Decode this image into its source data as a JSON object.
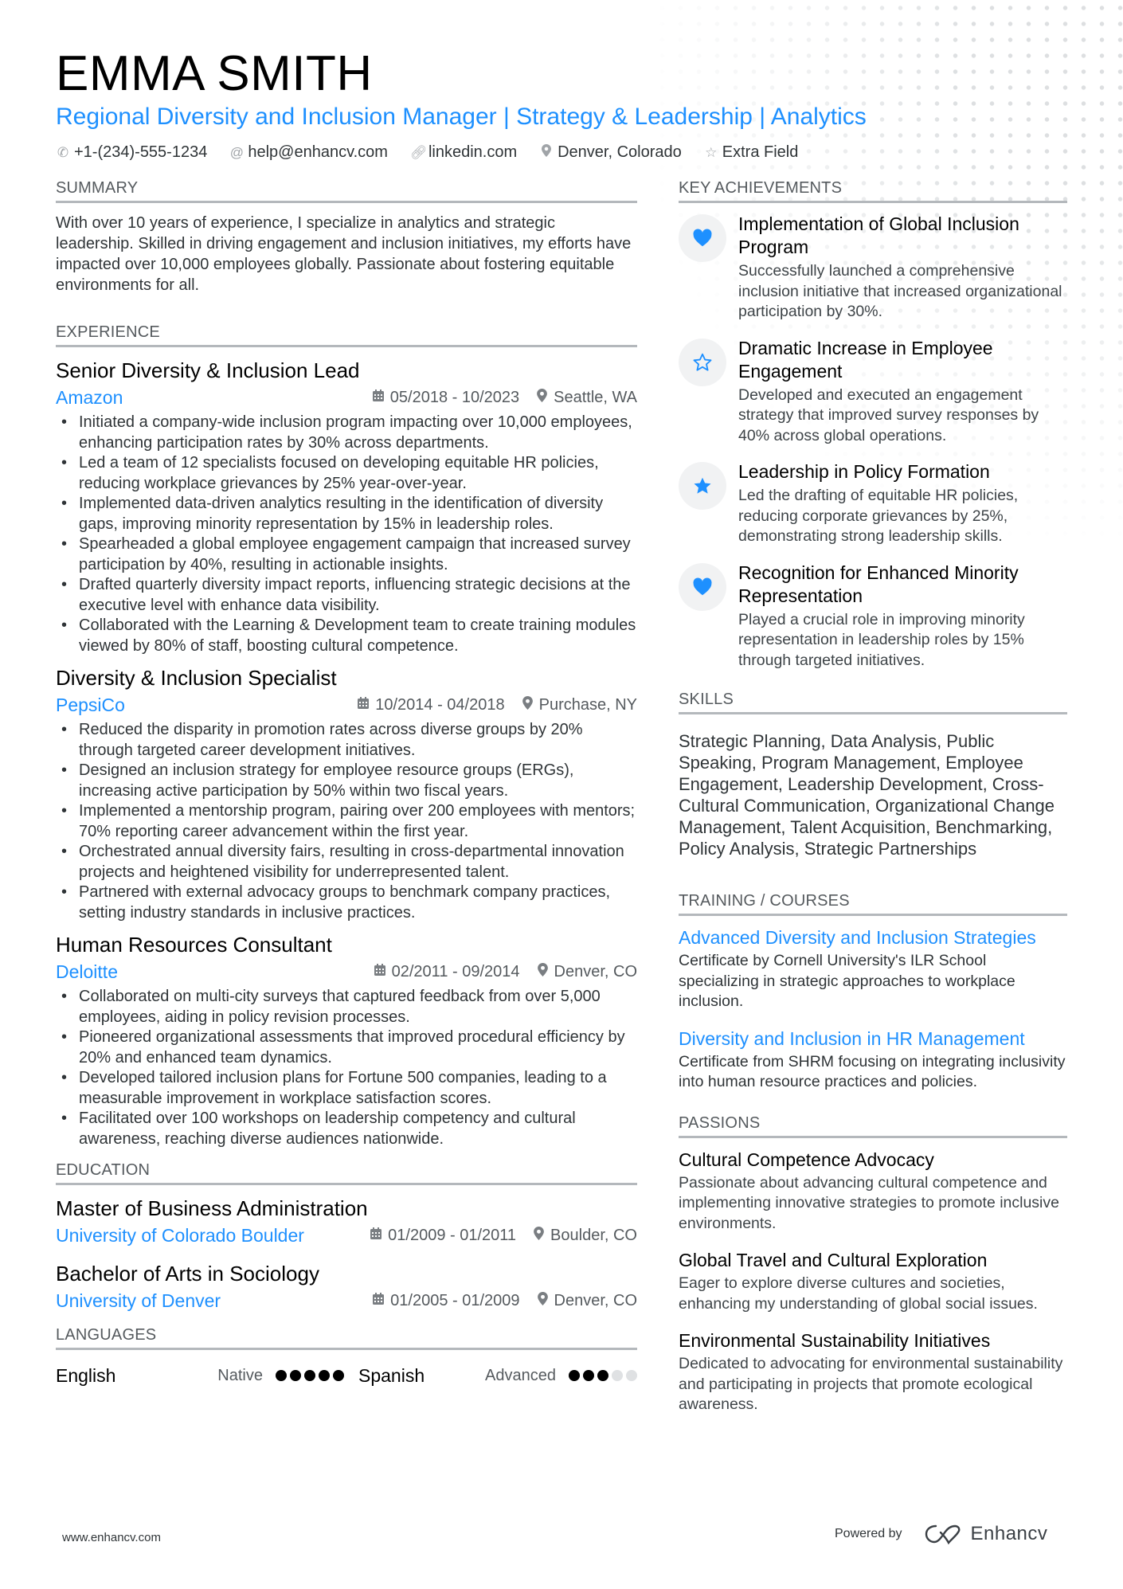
{
  "header": {
    "name": "EMMA SMITH",
    "title": "Regional Diversity and Inclusion Manager | Strategy & Leadership | Analytics",
    "contacts": [
      {
        "icon": "phone-icon",
        "text": "+1-(234)-555-1234"
      },
      {
        "icon": "at-icon",
        "text": "help@enhancv.com"
      },
      {
        "icon": "link-icon",
        "text": "linkedin.com"
      },
      {
        "icon": "location-pin-icon",
        "text": "Denver, Colorado"
      },
      {
        "icon": "star-outline-icon",
        "text": "Extra Field"
      }
    ]
  },
  "summary": {
    "heading": "SUMMARY",
    "text": "With over 10 years of experience, I specialize in analytics and strategic leadership. Skilled in driving engagement and inclusion initiatives, my efforts have impacted over 10,000 employees globally. Passionate about fostering equitable environments for all."
  },
  "experience": {
    "heading": "EXPERIENCE",
    "jobs": [
      {
        "title": "Senior Diversity & Inclusion Lead",
        "company": "Amazon",
        "dates": "05/2018 - 10/2023",
        "location": "Seattle, WA",
        "bullets": [
          "Initiated a company-wide inclusion program impacting over 10,000 employees, enhancing participation rates by 30% across departments.",
          "Led a team of 12 specialists focused on developing equitable HR policies, reducing workplace grievances by 25% year-over-year.",
          "Implemented data-driven analytics resulting in the identification of diversity gaps, improving minority representation by 15% in leadership roles.",
          "Spearheaded a global employee engagement campaign that increased survey participation by 40%, resulting in actionable insights.",
          "Drafted quarterly diversity impact reports, influencing strategic decisions at the executive level with enhance data visibility.",
          "Collaborated with the Learning & Development team to create training modules viewed by 80% of staff, boosting cultural competence."
        ]
      },
      {
        "title": "Diversity & Inclusion Specialist",
        "company": "PepsiCo",
        "dates": "10/2014 - 04/2018",
        "location": "Purchase, NY",
        "bullets": [
          "Reduced the disparity in promotion rates across diverse groups by 20% through targeted career development initiatives.",
          "Designed an inclusion strategy for employee resource groups (ERGs), increasing active participation by 50% within two fiscal years.",
          "Implemented a mentorship program, pairing over 200 employees with mentors; 70% reporting career advancement within the first year.",
          "Orchestrated annual diversity fairs, resulting in cross-departmental innovation projects and heightened visibility for underrepresented talent.",
          "Partnered with external advocacy groups to benchmark company practices, setting industry standards in inclusive practices."
        ]
      },
      {
        "title": "Human Resources Consultant",
        "company": "Deloitte",
        "dates": "02/2011 - 09/2014",
        "location": "Denver, CO",
        "bullets": [
          "Collaborated on multi-city surveys that captured feedback from over 5,000 employees, aiding in policy revision processes.",
          "Pioneered organizational assessments that improved procedural efficiency by 20% and enhanced team dynamics.",
          "Developed tailored inclusion plans for Fortune 500 companies, leading to a measurable improvement in workplace satisfaction scores.",
          "Facilitated over 100 workshops on leadership competency and cultural awareness, reaching diverse audiences nationwide."
        ]
      }
    ]
  },
  "education": {
    "heading": "EDUCATION",
    "items": [
      {
        "degree": "Master of Business Administration",
        "school": "University of Colorado Boulder",
        "dates": "01/2009 - 01/2011",
        "location": "Boulder, CO"
      },
      {
        "degree": "Bachelor of Arts in Sociology",
        "school": "University of Denver",
        "dates": "01/2005 - 01/2009",
        "location": "Denver, CO"
      }
    ]
  },
  "languages": {
    "heading": "LANGUAGES",
    "items": [
      {
        "name": "English",
        "level": "Native",
        "rating": 5,
        "max": 5
      },
      {
        "name": "Spanish",
        "level": "Advanced",
        "rating": 3,
        "max": 5
      }
    ]
  },
  "achievements": {
    "heading": "KEY ACHIEVEMENTS",
    "items": [
      {
        "icon": "heart-icon",
        "title": "Implementation of Global Inclusion Program",
        "desc": "Successfully launched a comprehensive inclusion initiative that increased organizational participation by 30%."
      },
      {
        "icon": "star-outline-icon",
        "title": "Dramatic Increase in Employee Engagement",
        "desc": "Developed and executed an engagement strategy that improved survey responses by 40% across global operations."
      },
      {
        "icon": "star-icon",
        "title": "Leadership in Policy Formation",
        "desc": "Led the drafting of equitable HR policies, reducing corporate grievances by 25%, demonstrating strong leadership skills."
      },
      {
        "icon": "heart-icon",
        "title": "Recognition for Enhanced Minority Representation",
        "desc": "Played a crucial role in improving minority representation in leadership roles by 15% through targeted initiatives."
      }
    ]
  },
  "skills": {
    "heading": "SKILLS",
    "text": "Strategic Planning, Data Analysis, Public Speaking, Program Management, Employee Engagement, Leadership Development, Cross-Cultural Communication, Organizational Change Management, Talent Acquisition, Benchmarking, Policy Analysis, Strategic Partnerships"
  },
  "training": {
    "heading": "TRAINING / COURSES",
    "items": [
      {
        "title": "Advanced Diversity and Inclusion Strategies",
        "desc": "Certificate by Cornell University's ILR School specializing in strategic approaches to workplace inclusion."
      },
      {
        "title": "Diversity and Inclusion in HR Management",
        "desc": "Certificate from SHRM focusing on integrating inclusivity into human resource practices and policies."
      }
    ]
  },
  "passions": {
    "heading": "PASSIONS",
    "items": [
      {
        "title": "Cultural Competence Advocacy",
        "desc": "Passionate about advancing cultural competence and implementing innovative strategies to promote inclusive environments."
      },
      {
        "title": "Global Travel and Cultural Exploration",
        "desc": "Eager to explore diverse cultures and societies, enhancing my understanding of global social issues."
      },
      {
        "title": "Environmental Sustainability Initiatives",
        "desc": "Dedicated to advocating for environmental sustainability and participating in projects that promote ecological awareness."
      }
    ]
  },
  "footer": {
    "website": "www.enhancv.com",
    "powered_by": "Powered by",
    "brand": "Enhancv"
  },
  "colors": {
    "accent": "#1e90ff",
    "text": "#2f3437",
    "heading_rule": "#b4b8bc"
  }
}
